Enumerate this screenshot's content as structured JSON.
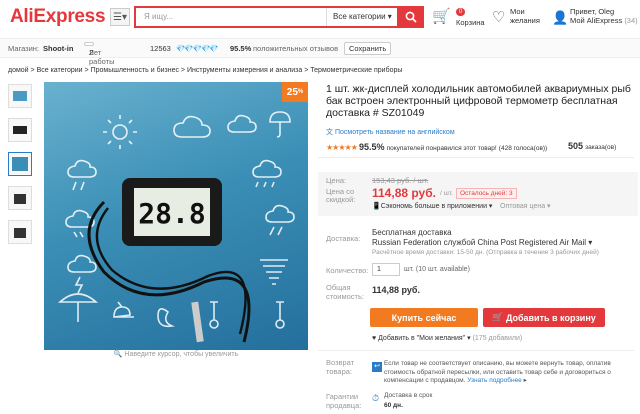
{
  "header": {
    "logo": "AliExpress",
    "search_placeholder": "Я ищу...",
    "search_category": "Все категории",
    "cart_label": "Корзина",
    "cart_count": "0",
    "wishlist_label_1": "Мои",
    "wishlist_label_2": "желания",
    "greeting": "Привет, Oleg",
    "my_aliexpress": "Мой AliExpress",
    "messages_count": "(34)"
  },
  "store": {
    "label": "Магазин:",
    "name": "Shoot-in",
    "years": "Лет работы",
    "years_count": "2",
    "rating_count": "12563",
    "feedback_pct": "95.5%",
    "feedback_label": "положительных отзывов",
    "save_button": "Сохранить"
  },
  "breadcrumb": [
    "домой",
    "Все категории",
    "Промышленность и бизнес",
    "Инструменты измерения и анализа",
    "Термометрические приборы"
  ],
  "gallery": {
    "sale_badge": "25",
    "thermo_reading": "28.8",
    "hint": "Наведите курсор, чтобы увеличить"
  },
  "product": {
    "title": "1 шт. жк-дисплей холодильник автомобилей аквариумных рыб бак встроен электронный цифровой термометр бесплатная доставка # SZ01049",
    "translate_link": "Посмотреть название на английском",
    "rating_pct": "95.5%",
    "rating_text": "покупателей понравился этот товар!",
    "votes": "(428 голоса(ов))",
    "orders_count": "505",
    "orders_label": "заказа(ов)"
  },
  "price": {
    "old_label": "Цена:",
    "old_price": "153,43 руб. / шт.",
    "discount_label_1": "Цена со",
    "discount_label_2": "скидкой:",
    "new_price": "114,88 руб.",
    "unit": "/ шт.",
    "left_time": "Осталось дней: 3",
    "app_saving": "Сэкономь больше в приложении",
    "wholesale": "Оптовая цена"
  },
  "shipping": {
    "label": "Доставка:",
    "free": "Бесплатная доставка",
    "route": "Russian Federation службой China Post Registered Air Mail",
    "estimate": "Расчётное время доставки: 15-50 дн. (Отправка в течение 3 рабочих дней)"
  },
  "quantity": {
    "label": "Количество:",
    "value": "1",
    "available": "шт. (10 шт. available)"
  },
  "total": {
    "label_1": "Общая",
    "label_2": "стоимость:",
    "value": "114,88 руб."
  },
  "actions": {
    "buy_now": "Купить сейчас",
    "add_to_cart": "Добавить в корзину",
    "wishlist": "Добавить в \"Мои желания\"",
    "wishlist_count": "(175 добавили)"
  },
  "returns": {
    "label_1": "Возврат",
    "label_2": "товара:",
    "text": "Если товар не соответствует описанию, вы можете вернуть товар, оплатив стоимость обратной пересылки, или оставить товар себе и договориться о компенсации с продавцом.",
    "link": "Узнать подробнее"
  },
  "guarantee": {
    "label_1": "Гарантии",
    "label_2": "продавца:",
    "text": "Доставка в срок",
    "days": "60 дн."
  },
  "colors": {
    "brand_red": "#e4393c",
    "orange": "#f27b21",
    "link_blue": "#2a7cc7"
  }
}
